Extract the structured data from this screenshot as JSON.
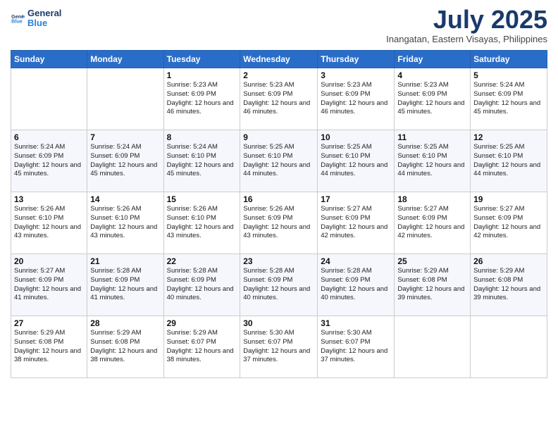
{
  "header": {
    "logo_line1": "General",
    "logo_line2": "Blue",
    "month": "July 2025",
    "location": "Inangatan, Eastern Visayas, Philippines"
  },
  "days_of_week": [
    "Sunday",
    "Monday",
    "Tuesday",
    "Wednesday",
    "Thursday",
    "Friday",
    "Saturday"
  ],
  "weeks": [
    [
      {
        "day": "",
        "info": ""
      },
      {
        "day": "",
        "info": ""
      },
      {
        "day": "1",
        "info": "Sunrise: 5:23 AM\nSunset: 6:09 PM\nDaylight: 12 hours and 46 minutes."
      },
      {
        "day": "2",
        "info": "Sunrise: 5:23 AM\nSunset: 6:09 PM\nDaylight: 12 hours and 46 minutes."
      },
      {
        "day": "3",
        "info": "Sunrise: 5:23 AM\nSunset: 6:09 PM\nDaylight: 12 hours and 46 minutes."
      },
      {
        "day": "4",
        "info": "Sunrise: 5:23 AM\nSunset: 6:09 PM\nDaylight: 12 hours and 45 minutes."
      },
      {
        "day": "5",
        "info": "Sunrise: 5:24 AM\nSunset: 6:09 PM\nDaylight: 12 hours and 45 minutes."
      }
    ],
    [
      {
        "day": "6",
        "info": "Sunrise: 5:24 AM\nSunset: 6:09 PM\nDaylight: 12 hours and 45 minutes."
      },
      {
        "day": "7",
        "info": "Sunrise: 5:24 AM\nSunset: 6:09 PM\nDaylight: 12 hours and 45 minutes."
      },
      {
        "day": "8",
        "info": "Sunrise: 5:24 AM\nSunset: 6:10 PM\nDaylight: 12 hours and 45 minutes."
      },
      {
        "day": "9",
        "info": "Sunrise: 5:25 AM\nSunset: 6:10 PM\nDaylight: 12 hours and 44 minutes."
      },
      {
        "day": "10",
        "info": "Sunrise: 5:25 AM\nSunset: 6:10 PM\nDaylight: 12 hours and 44 minutes."
      },
      {
        "day": "11",
        "info": "Sunrise: 5:25 AM\nSunset: 6:10 PM\nDaylight: 12 hours and 44 minutes."
      },
      {
        "day": "12",
        "info": "Sunrise: 5:25 AM\nSunset: 6:10 PM\nDaylight: 12 hours and 44 minutes."
      }
    ],
    [
      {
        "day": "13",
        "info": "Sunrise: 5:26 AM\nSunset: 6:10 PM\nDaylight: 12 hours and 43 minutes."
      },
      {
        "day": "14",
        "info": "Sunrise: 5:26 AM\nSunset: 6:10 PM\nDaylight: 12 hours and 43 minutes."
      },
      {
        "day": "15",
        "info": "Sunrise: 5:26 AM\nSunset: 6:10 PM\nDaylight: 12 hours and 43 minutes."
      },
      {
        "day": "16",
        "info": "Sunrise: 5:26 AM\nSunset: 6:09 PM\nDaylight: 12 hours and 43 minutes."
      },
      {
        "day": "17",
        "info": "Sunrise: 5:27 AM\nSunset: 6:09 PM\nDaylight: 12 hours and 42 minutes."
      },
      {
        "day": "18",
        "info": "Sunrise: 5:27 AM\nSunset: 6:09 PM\nDaylight: 12 hours and 42 minutes."
      },
      {
        "day": "19",
        "info": "Sunrise: 5:27 AM\nSunset: 6:09 PM\nDaylight: 12 hours and 42 minutes."
      }
    ],
    [
      {
        "day": "20",
        "info": "Sunrise: 5:27 AM\nSunset: 6:09 PM\nDaylight: 12 hours and 41 minutes."
      },
      {
        "day": "21",
        "info": "Sunrise: 5:28 AM\nSunset: 6:09 PM\nDaylight: 12 hours and 41 minutes."
      },
      {
        "day": "22",
        "info": "Sunrise: 5:28 AM\nSunset: 6:09 PM\nDaylight: 12 hours and 40 minutes."
      },
      {
        "day": "23",
        "info": "Sunrise: 5:28 AM\nSunset: 6:09 PM\nDaylight: 12 hours and 40 minutes."
      },
      {
        "day": "24",
        "info": "Sunrise: 5:28 AM\nSunset: 6:09 PM\nDaylight: 12 hours and 40 minutes."
      },
      {
        "day": "25",
        "info": "Sunrise: 5:29 AM\nSunset: 6:08 PM\nDaylight: 12 hours and 39 minutes."
      },
      {
        "day": "26",
        "info": "Sunrise: 5:29 AM\nSunset: 6:08 PM\nDaylight: 12 hours and 39 minutes."
      }
    ],
    [
      {
        "day": "27",
        "info": "Sunrise: 5:29 AM\nSunset: 6:08 PM\nDaylight: 12 hours and 38 minutes."
      },
      {
        "day": "28",
        "info": "Sunrise: 5:29 AM\nSunset: 6:08 PM\nDaylight: 12 hours and 38 minutes."
      },
      {
        "day": "29",
        "info": "Sunrise: 5:29 AM\nSunset: 6:07 PM\nDaylight: 12 hours and 38 minutes."
      },
      {
        "day": "30",
        "info": "Sunrise: 5:30 AM\nSunset: 6:07 PM\nDaylight: 12 hours and 37 minutes."
      },
      {
        "day": "31",
        "info": "Sunrise: 5:30 AM\nSunset: 6:07 PM\nDaylight: 12 hours and 37 minutes."
      },
      {
        "day": "",
        "info": ""
      },
      {
        "day": "",
        "info": ""
      }
    ]
  ]
}
